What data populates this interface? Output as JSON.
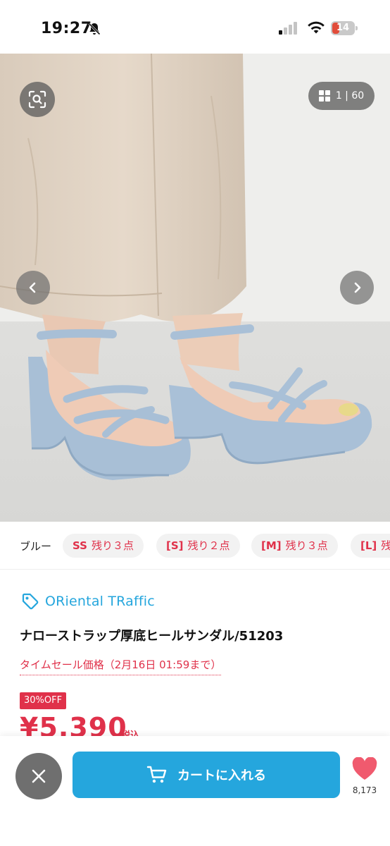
{
  "status": {
    "time": "19:27",
    "battery": "14"
  },
  "gallery": {
    "counter": "1 | 60"
  },
  "variants": {
    "color": "ブルー",
    "chips": [
      {
        "size": "SS",
        "stock": "残り３点"
      },
      {
        "size": "[S]",
        "stock": "残り２点"
      },
      {
        "size": "[M]",
        "stock": "残り３点"
      },
      {
        "size": "[L]",
        "stock": "残"
      }
    ]
  },
  "product": {
    "brand": "ORiental TRaffic",
    "title": "ナローストラップ厚底ヒールサンダル/51203",
    "sale_text": "タイムセール価格（2月16日 01:59まで）",
    "discount": "30%OFF",
    "price": "¥5,390",
    "tax_label": "税込"
  },
  "bottom_bar": {
    "cart_label": "カートに入れる",
    "favorite_count": "8,173"
  },
  "colors": {
    "accent_blue": "#25a6dd",
    "sale_red": "#e0314a",
    "heart_red": "#f05a6e"
  }
}
